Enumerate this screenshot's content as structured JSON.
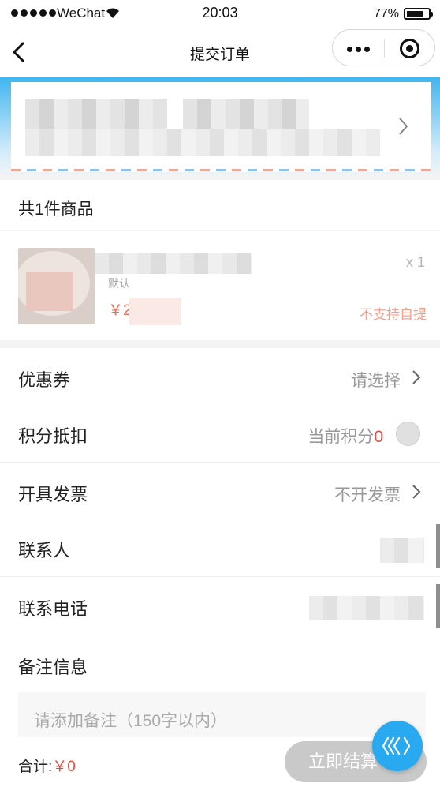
{
  "status_bar": {
    "carrier": "WeChat",
    "time": "20:03",
    "battery_percent": "77%",
    "battery_level": 0.77
  },
  "nav": {
    "title": "提交订单",
    "icons": [
      "back-arrow-icon",
      "more-dots-icon",
      "close-circle-icon"
    ]
  },
  "goods": {
    "count_label": "共1件商品",
    "item": {
      "qty": "x 1",
      "spec": "默认",
      "price_prefix": "￥2",
      "pickup_note": "不支持自提"
    }
  },
  "options": {
    "coupon": {
      "label": "优惠券",
      "value": "请选择"
    },
    "points": {
      "label": "积分抵扣",
      "value_prefix": "当前积分",
      "value_number": "0"
    },
    "invoice": {
      "label": "开具发票",
      "value": "不开发票"
    },
    "contact": {
      "label": "联系人"
    },
    "phone": {
      "label": "联系电话"
    },
    "remark": {
      "label": "备注信息",
      "placeholder": "请添加备注（150字以内）"
    }
  },
  "footer": {
    "total_label": "合计:",
    "total_value": "￥0",
    "checkout_label": "立即结算"
  },
  "colors": {
    "accent_red": "#e54d42",
    "header_blue": "#3fb5f0",
    "disabled_button": "#c9c9c9",
    "float_button": "#29a9f0"
  }
}
